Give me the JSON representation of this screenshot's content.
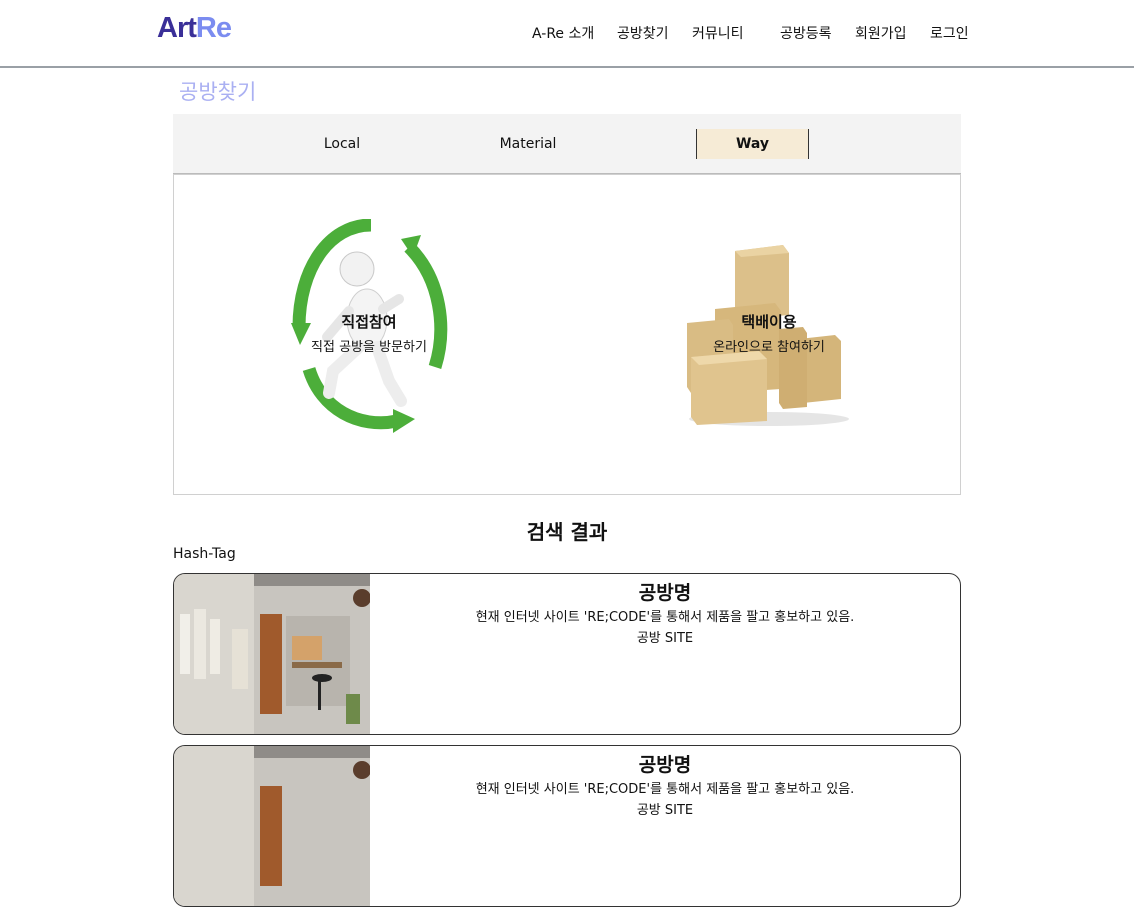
{
  "header": {
    "logo_part1": "Art",
    "logo_part2": "Re",
    "nav": [
      "A-Re 소개",
      "공방찾기",
      "커뮤니티",
      "공방등록",
      "회원가입",
      "로그인"
    ]
  },
  "page_title": "공방찾기",
  "tabs": [
    {
      "label": "Local",
      "active": false
    },
    {
      "label": "Material",
      "active": false
    },
    {
      "label": "Way",
      "active": true
    }
  ],
  "way_options": [
    {
      "title": "직접참여",
      "subtitle": "직접 공방을 방문하기",
      "icon": "running-person-recycle-icon"
    },
    {
      "title": "택배이용",
      "subtitle": "온라인으로 참여하기",
      "icon": "parcel-boxes-icon"
    }
  ],
  "results": {
    "title": "검색 결과",
    "hashtag": "Hash-Tag",
    "cards": [
      {
        "name": "공방명",
        "description": "현재 인터넷 사이트 'RE;CODE'를 통해서 제품을 팔고 홍보하고 있음.",
        "site": "공방 SITE"
      },
      {
        "name": "공방명",
        "description": "현재 인터넷 사이트 'RE;CODE'를 통해서 제품을 팔고 홍보하고 있음.",
        "site": "공방 SITE"
      }
    ]
  },
  "colors": {
    "logo_dark": "#3a2f98",
    "logo_light": "#7b8cf0",
    "page_title": "#aab0f2",
    "active_tab": "#f6ebd6",
    "arrow_green": "#4cae3a",
    "box_tan": "#dcc08a"
  }
}
